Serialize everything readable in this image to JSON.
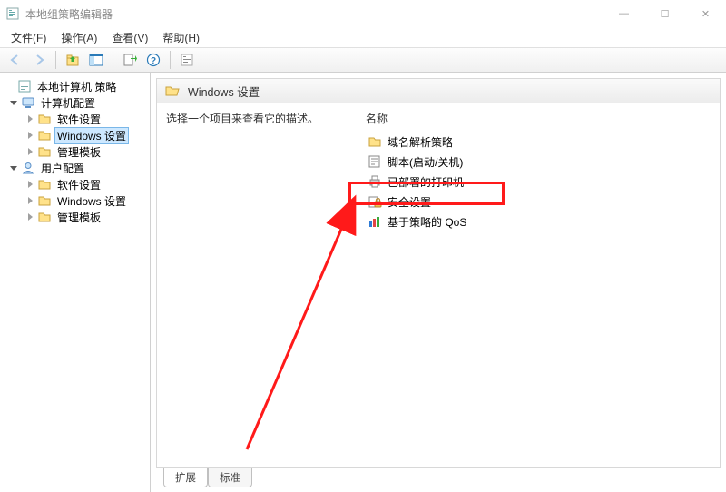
{
  "window": {
    "title": "本地组策略编辑器",
    "controls": {
      "min": "—",
      "max": "☐",
      "close": "✕"
    }
  },
  "menu": {
    "file": "文件(F)",
    "action": "操作(A)",
    "view": "查看(V)",
    "help": "帮助(H)"
  },
  "tree": {
    "root": "本地计算机 策略",
    "computer": "计算机配置",
    "c_software": "软件设置",
    "c_windows": "Windows 设置",
    "c_admin": "管理模板",
    "user": "用户配置",
    "u_software": "软件设置",
    "u_windows": "Windows 设置",
    "u_admin": "管理模板"
  },
  "content": {
    "header": "Windows 设置",
    "description": "选择一个项目来查看它的描述。",
    "column_name": "名称",
    "items": {
      "dns": "域名解析策略",
      "scripts": "脚本(启动/关机)",
      "printers": "已部署的打印机",
      "security": "安全设置",
      "qos": "基于策略的 QoS"
    }
  },
  "tabs": {
    "extended": "扩展",
    "standard": "标准"
  }
}
